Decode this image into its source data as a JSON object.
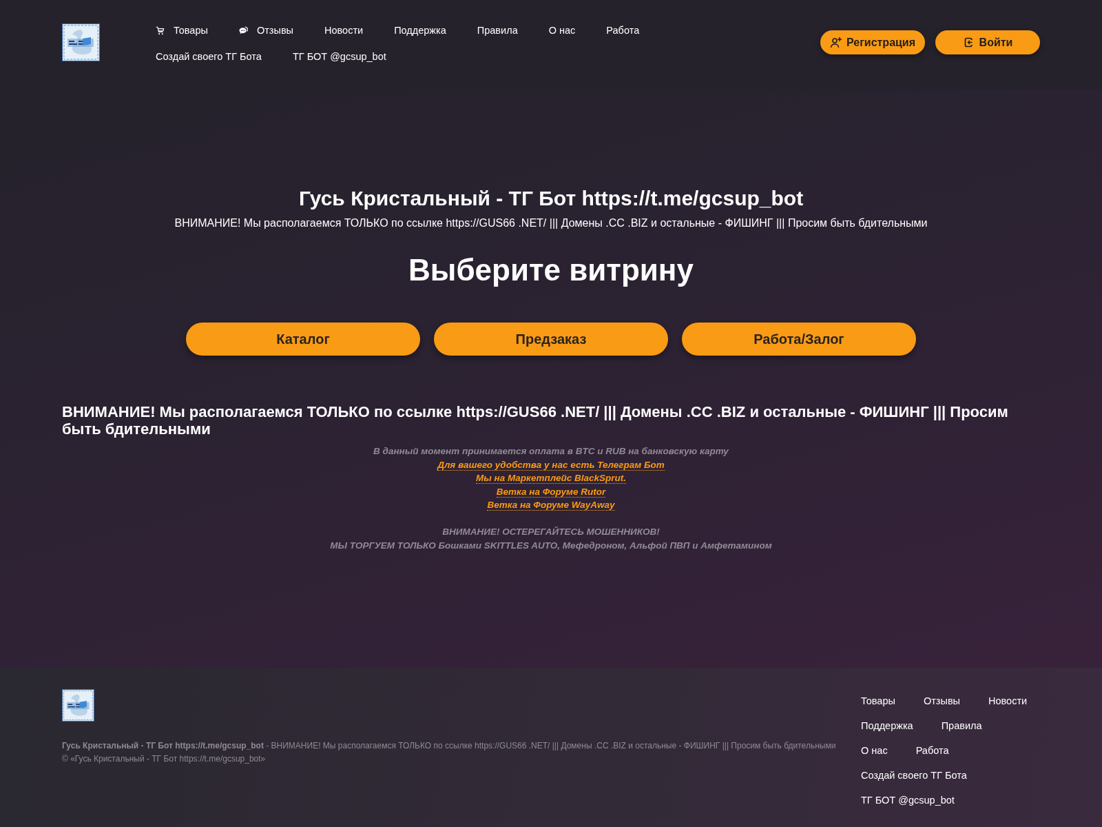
{
  "header": {
    "nav_rows": [
      [
        {
          "label": "Товары",
          "kind": "products"
        },
        {
          "label": "Отзывы",
          "kind": "reviews"
        },
        {
          "label": "Новости",
          "kind": "plain"
        },
        {
          "label": "Поддержка",
          "kind": "plain"
        },
        {
          "label": "Правила",
          "kind": "plain"
        },
        {
          "label": "О нас",
          "kind": "plain"
        },
        {
          "label": "Работа",
          "kind": "plain"
        }
      ],
      [
        {
          "label": "Создай своего ТГ Бота",
          "kind": "plain"
        },
        {
          "label": "ТГ БОТ @gcsup_bot",
          "kind": "plain"
        }
      ]
    ],
    "buttons": [
      {
        "label": "Регистрация",
        "kind": "register"
      },
      {
        "label": "Войти",
        "kind": "login"
      }
    ]
  },
  "hero": {
    "title": "Гусь Кристальный - ТГ Бот https://t.me/gcsup_bot",
    "subtitle": "ВНИМАНИЕ! Мы располагаемся ТОЛЬКО по ссылке https://GUS66 .NET/ ||| Домены .CC .BIZ и остальные - ФИШИНГ ||| Просим быть бдительными",
    "heading": "Выберите витрину",
    "buttons": [
      "Каталог",
      "Предзаказ",
      "Работа/Залог"
    ]
  },
  "notice": {
    "heading": "ВНИМАНИЕ! Мы располагаемся ТОЛЬКО по ссылке https://GUS66 .NET/ ||| Домены .CC .BIZ и остальные - ФИШИНГ ||| Просим быть бдительными",
    "paragraphs": [
      {
        "lines": [
          {
            "kind": "text",
            "text": "В данный момент принимается оплата в BTC и RUB на банковскую карту"
          },
          {
            "kind": "link",
            "text": "Для вашего удобства у нас есть Телеграм Бот"
          },
          {
            "kind": "link",
            "text": "Мы на Маркетплейс BlackSprut."
          },
          {
            "kind": "link",
            "text": "Ветка на Форуме Rutor"
          },
          {
            "kind": "link",
            "text": "Ветка на Форуме WayAway"
          }
        ]
      },
      {
        "lines": [
          {
            "kind": "text",
            "text": "ВНИМАНИЕ! ОСТЕРЕГАЙТЕСЬ МОШЕННИКОВ!"
          },
          {
            "kind": "text",
            "text": "МЫ ТОРГУЕМ ТОЛЬКО Бошками SKITTLES AUTO, Мефедроном, Альфой ПВП и Амфетамином"
          }
        ]
      }
    ]
  },
  "footer": {
    "about": "**Гусь Кристальный - ТГ Бот https://t.me/gcsup_bot** - ВНИМАНИЕ! Мы располагаемся ТОЛЬКО по ссылке https://GUS66 .NET/ ||| Домены .CC .BIZ и остальные - ФИШИНГ ||| Просим быть бдительными",
    "copyright": "© «Гусь Кристальный - ТГ Бот https://t.me/gcsup_bot»",
    "nav_rows": [
      [
        "Товары",
        "Отзывы",
        "Новости"
      ],
      [
        "Поддержка",
        "Правила"
      ],
      [
        "О нас",
        "Работа"
      ],
      [
        "Создай своего ТГ Бота"
      ],
      [
        "ТГ БОТ @gcsup_bot"
      ]
    ]
  }
}
